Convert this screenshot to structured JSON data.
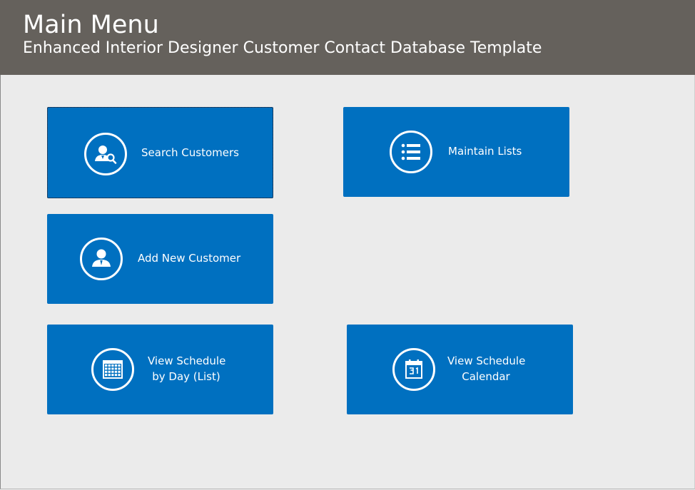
{
  "header": {
    "title": "Main Menu",
    "subtitle": "Enhanced Interior Designer Customer Contact Database Template",
    "background": "#65615c"
  },
  "tiles": {
    "search_customers": {
      "label": "Search Customers",
      "icon": "search-customer-icon"
    },
    "maintain_lists": {
      "label": "Maintain Lists",
      "icon": "list-icon"
    },
    "add_new_customer": {
      "label": "Add New Customer",
      "icon": "person-icon"
    },
    "view_schedule_list": {
      "label_line1": "View Schedule",
      "label_line2": "by Day (List)",
      "icon": "calendar-grid-icon"
    },
    "view_schedule_calendar": {
      "label_line1": "View Schedule",
      "label_line2": "Calendar",
      "icon": "calendar-31-icon"
    }
  },
  "colors": {
    "tile": "#0070c0",
    "background": "#ebebeb",
    "text": "#ffffff"
  }
}
